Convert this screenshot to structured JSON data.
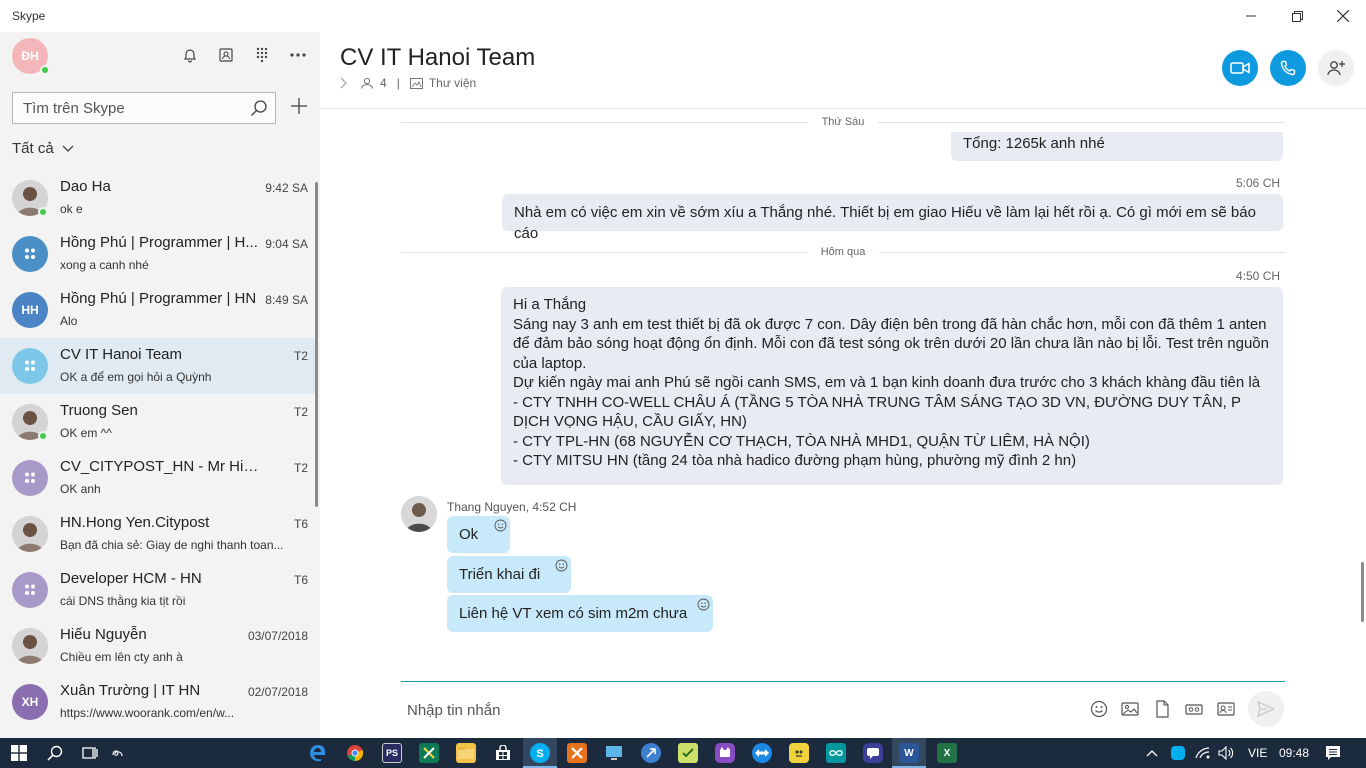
{
  "window": {
    "title": "Skype",
    "minimize_icon": "minimize-icon",
    "maximize_icon": "restore-icon",
    "close_icon": "close-icon"
  },
  "sidebar": {
    "me_initials": "ĐH",
    "search_placeholder": "Tìm trên Skype",
    "filter_label": "Tất cả",
    "contacts": [
      {
        "name": "Dao Ha",
        "message": "ok e",
        "time": "9:42 SA",
        "avatar": "photo",
        "online": true
      },
      {
        "name": "Hồng Phú | Programmer | H...",
        "message": "xong a canh nhé",
        "time": "9:04 SA",
        "avatar": "group",
        "color": "#4a90c6"
      },
      {
        "name": "Hồng Phú | Programmer | HN",
        "message": "Alo",
        "time": "8:49 SA",
        "avatar": "initials",
        "initials": "HH",
        "color": "#4a84c4"
      },
      {
        "name": "CV IT Hanoi Team",
        "message": "OK a để em gọi hỏi a Quỳnh",
        "time": "T2",
        "avatar": "group",
        "color": "#7dc8e8",
        "active": true
      },
      {
        "name": "Truong Sen",
        "message": "OK em ^^",
        "time": "T2",
        "avatar": "photo",
        "online": true
      },
      {
        "name": "CV_CITYPOST_HN - Mr Hiếu",
        "message": "OK anh",
        "time": "T2",
        "avatar": "group",
        "color": "#a89ac8"
      },
      {
        "name": "HN.Hong Yen.Citypost",
        "message": "Bạn đã chia sẻ: Giay de nghi thanh toan...",
        "time": "T6",
        "avatar": "photo"
      },
      {
        "name": "Developer HCM - HN",
        "message": "cái DNS thằng kia tịt rồi",
        "time": "T6",
        "avatar": "group",
        "color": "#a89ac8"
      },
      {
        "name": "Hiếu Nguyễn",
        "message": "Chiều em lên cty anh à",
        "time": "03/07/2018",
        "avatar": "photo"
      },
      {
        "name": "Xuân Trường | IT HN",
        "message": "https://www.woorank.com/en/w...",
        "time": "02/07/2018",
        "avatar": "initials",
        "initials": "XH",
        "color": "#8a6eb0"
      }
    ]
  },
  "chat": {
    "title": "CV IT Hanoi Team",
    "member_count": "4",
    "separator": "|",
    "gallery_label": "Thư viện",
    "accent": "#0f9ae0",
    "day1": "Thứ Sáu",
    "msg_total": "Tổng: 1265k anh nhé",
    "time_506": "5:06 CH",
    "msg_leave": "Nhà em có việc em xin về sớm xíu a Thắng nhé. Thiết bị em giao Hiếu về làm lại hết rồi ạ. Có gì mới em sẽ báo cáo",
    "day2": "Hôm qua",
    "time_450": "4:50 CH",
    "report_lines": [
      "Hi a Thắng",
      "Sáng nay 3 anh em test thiết bị đã ok được 7 con. Dây điện bên trong đã hàn chắc hơn, mỗi con đã thêm 1 anten để đảm bảo sóng hoạt động ổn định. Mỗi con đã test sóng ok trên dưới 20 lần chưa lần nào bị lỗi. Test trên nguồn của laptop.",
      "Dự kiến ngày mai anh Phú sẽ ngồi canh SMS, em và 1 bạn kinh doanh đưa trước cho 3 khách khàng đầu tiên là",
      "- CTY TNHH CO-WELL CHÂU Á (TẦNG 5 TÒA NHÀ TRUNG TÂM SÁNG TẠO 3D VN, ĐƯỜNG DUY TÂN, P DỊCH VỌNG HẬU, CẦU GIẤY, HN)",
      "- CTY TPL-HN (68 NGUYỄN CƠ THẠCH, TÒA NHÀ MHD1, QUẬN TỪ LIÊM, HÀ NỘI)",
      "- CTY MITSU HN (tầng 24 tòa nhà hadico đường phạm hùng, phường mỹ đình 2 hn)"
    ],
    "sender_line": "Thang Nguyen, 4:52 CH",
    "replies": [
      "Ok",
      "Triển khai đi",
      "Liên hệ VT xem có sim m2m chưa"
    ],
    "composer_placeholder": "Nhập tin nhắn"
  },
  "taskbar": {
    "language": "VIE",
    "clock": "09:48"
  }
}
